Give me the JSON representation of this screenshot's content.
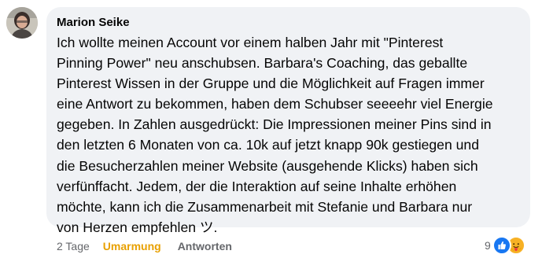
{
  "comment": {
    "author": "Marion Seike",
    "text": "Ich wollte meinen Account vor einem halben Jahr mit \"Pinterest\nPinning Power\" neu anschubsen. Barbara's Coaching, das geballte\nPinterest Wissen in der Gruppe und die Möglichkeit auf Fragen immer\neine Antwort zu bekommen, haben dem Schubser seeeehr viel Energie\ngegeben. In Zahlen ausgedrückt: Die Impressionen meiner Pins sind in\nden letzten 6 Monaten von ca. 10k auf jetzt knapp 90k gestiegen und\ndie Besucherzahlen meiner Website (ausgehende Klicks) haben sich\nverfünffacht. Jedem, der die Interaktion auf seine Inhalte erhöhen\nmöchte, kann ich die Zusammenarbeit mit Stefanie und Barbara nur\nvon Herzen empfehlen ツ.",
    "timestamp": "2 Tage",
    "reaction_label": "Umarmung",
    "reply_label": "Antworten",
    "reaction_count": "9",
    "reaction_types": [
      "like-icon",
      "care-icon"
    ]
  },
  "colors": {
    "bubble_bg": "#f0f2f5",
    "reaction_active": "#e8a000",
    "meta_text": "#65676b",
    "like_blue": "#1877f2",
    "care_yellow": "#f7b125"
  }
}
